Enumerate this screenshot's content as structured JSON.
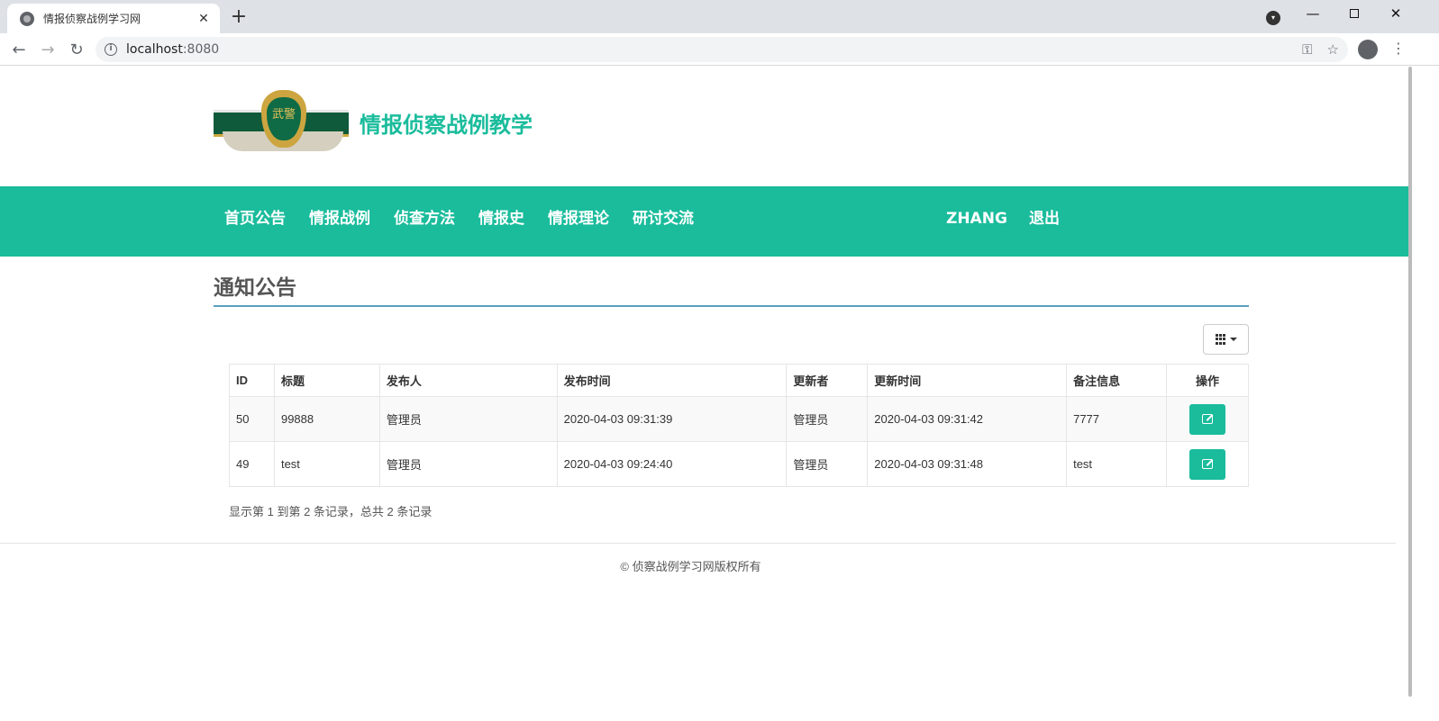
{
  "browser": {
    "tab_title": "情报侦察战例学习网",
    "tab_close": "✕",
    "new_tab": "+",
    "url_host": "localhost",
    "url_port": ":8080",
    "window_controls": {
      "minimize": "—",
      "close": "✕"
    }
  },
  "site": {
    "title": "情报侦察战例教学",
    "emblem_text": "武警"
  },
  "nav": {
    "items": [
      "首页公告",
      "情报战例",
      "侦查方法",
      "情报史",
      "情报理论",
      "研讨交流"
    ],
    "user": "ZHANG",
    "logout": "退出"
  },
  "section": {
    "title": "通知公告"
  },
  "table": {
    "headers": [
      "ID",
      "标题",
      "发布人",
      "发布时间",
      "更新者",
      "更新时间",
      "备注信息",
      "操作"
    ],
    "rows": [
      [
        "50",
        "99888",
        "管理员",
        "2020-04-03 09:31:39",
        "管理员",
        "2020-04-03 09:31:42",
        "7777"
      ],
      [
        "49",
        "test",
        "管理员",
        "2020-04-03 09:24:40",
        "管理员",
        "2020-04-03 09:31:48",
        "test"
      ]
    ]
  },
  "pager": {
    "info": "显示第 1 到第 2 条记录，总共 2 条记录"
  },
  "footer": {
    "text": "© 侦察战例学习网版权所有"
  },
  "colors": {
    "accent": "#1abc9c",
    "rule": "#5a9fbf"
  }
}
